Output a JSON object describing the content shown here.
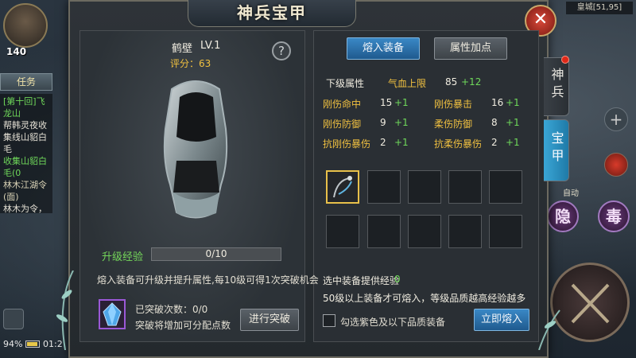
{
  "hud": {
    "level": "140",
    "task_tab": "任务",
    "quests": [
      {
        "title": "[第十回]飞龙山",
        "desc": "帮韩灵夜收集线山貂白毛",
        "goal": "收集山貂白毛(0"
      },
      {
        "title": "林木江湖令(面)",
        "desc": "林木为令，扫除平，侠字为刀，间邪徒。"
      }
    ],
    "battery": "94%",
    "time": "01:2",
    "map_label": "皇城[51,95]",
    "auto_label": "自动",
    "skill_hide": "隐",
    "skill_poison": "毒",
    "plus_icon": "+"
  },
  "panel": {
    "title": "神兵宝甲",
    "close_symbol": "✕",
    "side_tabs": [
      {
        "label": "神兵",
        "active": false
      },
      {
        "label": "宝甲",
        "active": true
      }
    ],
    "equipment": {
      "name": "鹤壁",
      "level": "LV.1",
      "score": "评分：63"
    },
    "help_symbol": "?",
    "exp": {
      "label": "升级经验",
      "current": 0,
      "max": 10,
      "text": "0/10"
    },
    "merge_hint": "熔入装备可升级并提升属性,每10级可得1次突破机会",
    "break_count": "已突破次数：0/0",
    "break_hint": "突破将增加可分配点数",
    "break_button": "进行突破",
    "top_buttons": {
      "merge_equip": "熔入装备",
      "attr_points": "属性加点"
    },
    "next_attr_label": "下级属性",
    "hp": {
      "label": "气血上限",
      "value": "85",
      "inc": "+12"
    },
    "stats": [
      {
        "label": "刚伤命中",
        "value": "15",
        "inc": "+1"
      },
      {
        "label": "刚伤暴击",
        "value": "16",
        "inc": "+1"
      },
      {
        "label": "刚伤防御",
        "value": "9",
        "inc": "+1"
      },
      {
        "label": "柔伤防御",
        "value": "8",
        "inc": "+1"
      },
      {
        "label": "抗刚伤暴伤",
        "value": "2",
        "inc": "+1"
      },
      {
        "label": "抗柔伤暴伤",
        "value": "2",
        "inc": "+1"
      }
    ],
    "provide_exp_label": "选中装备提供经验",
    "provide_exp_value": "0",
    "level_hint": "50级以上装备才可熔入，等级品质越高经验越多",
    "checkbox_label": "勾选紫色及以下品质装备",
    "merge_now_button": "立即熔入",
    "colors": {
      "accent_blue": "#2f78b4",
      "gold": "#f0c040",
      "green": "#6fd85a",
      "close_red": "#c0301e",
      "crystal_purple": "#9a58d6"
    }
  }
}
